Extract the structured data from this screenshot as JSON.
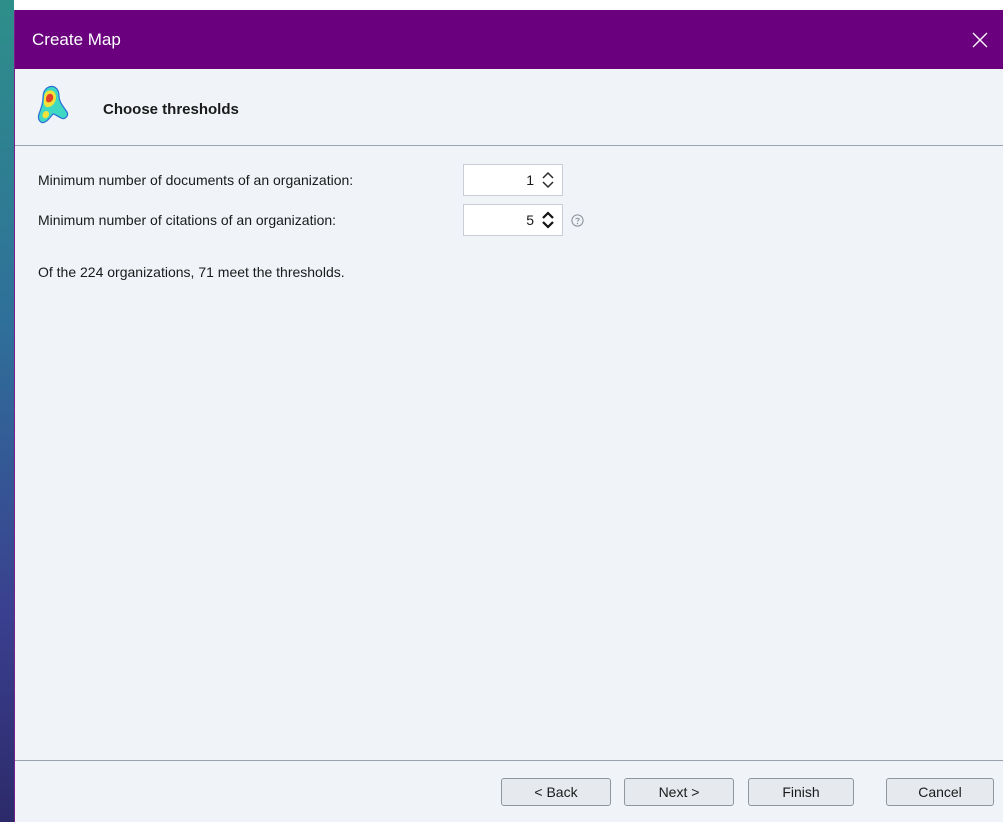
{
  "window": {
    "title": "Create Map",
    "close_icon": "close-icon",
    "titlebar_color": "#6a007e"
  },
  "header": {
    "logo_icon": "vosviewer-heatmap-logo-icon",
    "heading": "Choose thresholds"
  },
  "fields": [
    {
      "label": "Minimum number of documents of an organization:",
      "value": "1",
      "icon": "spinner-arrows-icon"
    },
    {
      "label": "Minimum number of citations of an organization:",
      "value": "5",
      "icon": "spinner-arrows-icon",
      "help_icon": "help-icon"
    }
  ],
  "summary": "Of the 224 organizations, 71 meet the thresholds.",
  "buttons": {
    "back": "< Back",
    "next": "Next >",
    "finish": "Finish",
    "cancel": "Cancel"
  }
}
